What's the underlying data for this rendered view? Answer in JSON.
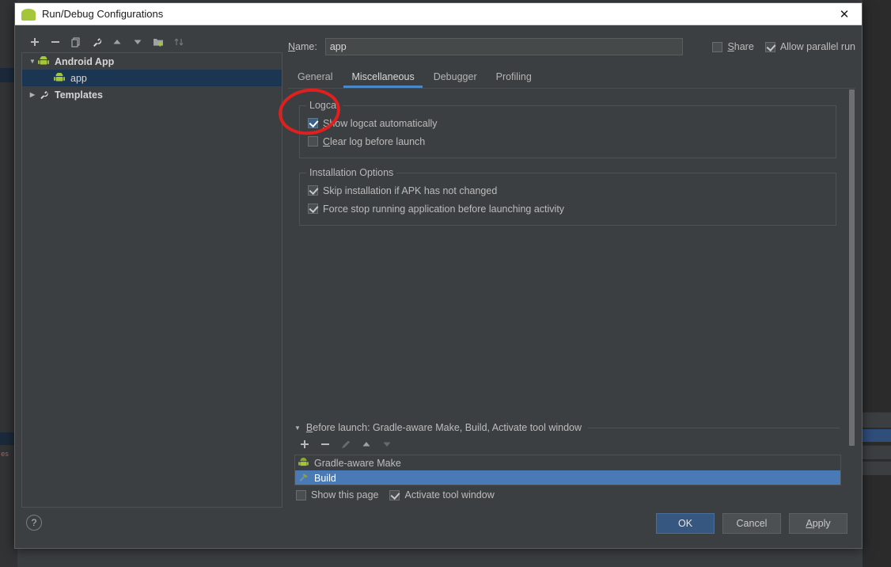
{
  "window": {
    "title": "Run/Debug Configurations",
    "app_icon": "android-robot-icon",
    "close_label": "✕"
  },
  "tree_toolbar": {
    "buttons": [
      {
        "name": "add-configuration-button",
        "glyph": "+",
        "enabled": true
      },
      {
        "name": "remove-configuration-button",
        "glyph": "–",
        "enabled": true
      },
      {
        "name": "copy-configuration-button",
        "glyph": "⧉",
        "enabled": true
      },
      {
        "name": "edit-templates-button",
        "glyph": "🔧",
        "enabled": true
      },
      {
        "name": "move-up-button",
        "glyph": "▲",
        "enabled": true
      },
      {
        "name": "move-down-button",
        "glyph": "▼",
        "enabled": true
      },
      {
        "name": "move-into-folder-button",
        "glyph": "὜0",
        "enabled": true
      },
      {
        "name": "sort-configurations-button",
        "glyph": "⇅",
        "enabled": false
      }
    ]
  },
  "tree": {
    "items": [
      {
        "label": "Android App",
        "level": 0,
        "expanded": true,
        "icon": "android-robot-icon",
        "selected": false,
        "bold": true,
        "arrow": "▼"
      },
      {
        "label": "app",
        "level": 1,
        "expanded": null,
        "icon": "android-robot-icon",
        "selected": true,
        "bold": false,
        "arrow": ""
      },
      {
        "label": "Templates",
        "level": 0,
        "expanded": false,
        "icon": "wrench-icon",
        "selected": false,
        "bold": true,
        "arrow": "▶"
      }
    ]
  },
  "name_field": {
    "label_prefix": "N",
    "label_rest": "ame:",
    "value": "app",
    "placeholder": ""
  },
  "header_options": [
    {
      "name": "share-checkbox",
      "label_prefix": "S",
      "label_rest": "hare",
      "checked": false,
      "style": "default"
    },
    {
      "name": "allow-parallel-run-checkbox",
      "label_prefix": "",
      "label_rest": "Allow parallel run",
      "checked": true,
      "style": "default"
    }
  ],
  "tabs": [
    {
      "label": "General",
      "active": false
    },
    {
      "label": "Miscellaneous",
      "active": true
    },
    {
      "label": "Debugger",
      "active": false
    },
    {
      "label": "Profiling",
      "active": false
    }
  ],
  "groups": [
    {
      "name": "logcat-group",
      "legend": "Logcat",
      "options": [
        {
          "name": "show-logcat-automatically-checkbox",
          "label_prefix": "S",
          "label_rest": "how logcat automatically",
          "checked": true,
          "style": "blue"
        },
        {
          "name": "clear-log-before-launch-checkbox",
          "label_prefix": "C",
          "label_rest": "lear log before launch",
          "checked": false,
          "style": "default"
        }
      ]
    },
    {
      "name": "installation-options-group",
      "legend": "Installation Options",
      "options": [
        {
          "name": "skip-installation-checkbox",
          "label_prefix": "",
          "label_rest": "Skip installation if APK has not changed",
          "checked": true,
          "style": "default"
        },
        {
          "name": "force-stop-checkbox",
          "label_prefix": "",
          "label_rest": "Force stop running application before launching activity",
          "checked": true,
          "style": "default"
        }
      ]
    }
  ],
  "before_launch": {
    "arrow": "▼",
    "title_prefix": "B",
    "title_rest": "efore launch: Gradle-aware Make, Build, Activate tool window",
    "toolbar": [
      {
        "name": "add-task-button",
        "glyph": "+",
        "enabled": true
      },
      {
        "name": "remove-task-button",
        "glyph": "–",
        "enabled": true
      },
      {
        "name": "edit-task-button",
        "glyph": "✎",
        "enabled": false
      },
      {
        "name": "task-move-up-button",
        "glyph": "▲",
        "enabled": true
      },
      {
        "name": "task-move-down-button",
        "glyph": "▼",
        "enabled": false
      }
    ],
    "tasks": [
      {
        "label": "Gradle-aware Make",
        "icon": "android-robot-icon",
        "selected": false
      },
      {
        "label": "Build",
        "icon": "hammer-icon",
        "selected": true
      }
    ],
    "bottom_options": [
      {
        "name": "show-this-page-checkbox",
        "label_prefix": "",
        "label_rest": "Show this page",
        "checked": false,
        "style": "default"
      },
      {
        "name": "activate-tool-window-checkbox",
        "label_prefix": "",
        "label_rest": "Activate tool window",
        "checked": true,
        "style": "default"
      }
    ]
  },
  "footer": {
    "help_label": "?",
    "buttons": [
      {
        "name": "ok-button",
        "label_prefix": "",
        "label_rest": "OK",
        "primary": true
      },
      {
        "name": "cancel-button",
        "label_prefix": "",
        "label_rest": "Cancel",
        "primary": false
      },
      {
        "name": "apply-button",
        "label_prefix": "A",
        "label_rest": "pply",
        "primary": false
      }
    ]
  },
  "annotation": {
    "type": "red-ellipse",
    "color": "#e01f1f",
    "target": "show-logcat-automatically-checkbox"
  },
  "colors": {
    "dialog_bg": "#3c3f41",
    "titlebar_bg": "#ffffff",
    "accent_blue": "#4a88c7",
    "selection_blue": "#4a7ab5",
    "tree_selection": "#1b3653",
    "annotation_red": "#e01f1f",
    "android_green": "#a4c639"
  }
}
